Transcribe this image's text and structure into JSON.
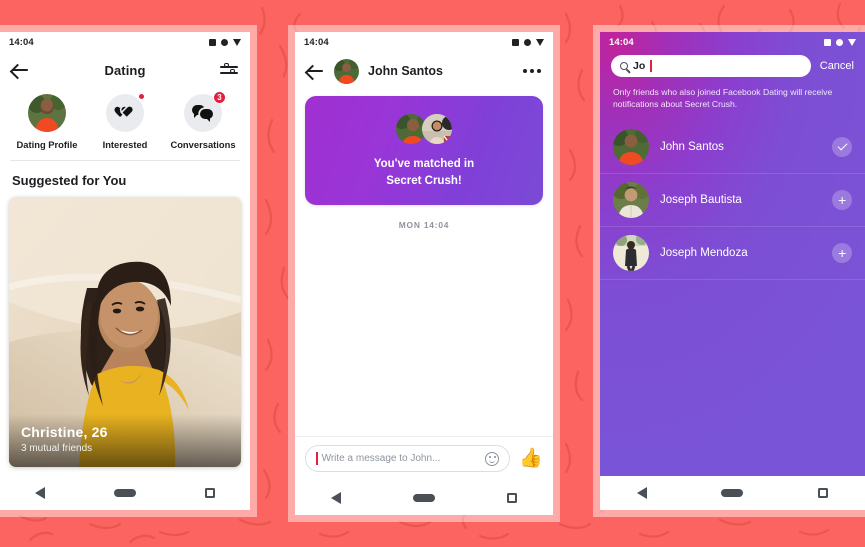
{
  "background": {
    "color": "#fb6461",
    "pattern": "squiggle-lines"
  },
  "phone1": {
    "status": {
      "time": "14:04",
      "icons": [
        "sim-icon",
        "circle-icon",
        "signal-triangle-icon"
      ]
    },
    "appbar": {
      "back": "back-arrow-icon",
      "title": "Dating",
      "settings": "filter-sliders-icon"
    },
    "shortcuts": [
      {
        "label": "Dating Profile",
        "icon": "profile-photo-icon",
        "badge": ""
      },
      {
        "label": "Interested",
        "icon": "hearts-icon",
        "badge": "dot"
      },
      {
        "label": "Conversations",
        "icon": "chat-bubbles-icon",
        "badge": "3"
      }
    ],
    "section_title": "Suggested for You",
    "card": {
      "name": "Christine, 26",
      "sub": "3 mutual friends"
    },
    "nav": [
      "back-nav-icon",
      "home-nav-icon",
      "recents-nav-icon"
    ]
  },
  "phone2": {
    "status": {
      "time": "14:04"
    },
    "appbar": {
      "back": "back-arrow-icon",
      "name": "John Santos",
      "menu": "overflow-menu-icon"
    },
    "banner": {
      "text_line1": "You've matched in",
      "text_line2": "Secret Crush!",
      "gradient_from": "#a02fd0",
      "gradient_to": "#7b4ad6"
    },
    "message_time": "MON 14:04",
    "composer": {
      "placeholder": "Write a message to John...",
      "emoji": "smiley-icon",
      "like": "thumbs-up-icon"
    },
    "nav": [
      "back-nav-icon",
      "home-nav-icon",
      "recents-nav-icon"
    ]
  },
  "phone3": {
    "status": {
      "time": "14:04"
    },
    "search": {
      "value": "Jo",
      "icon": "search-icon",
      "cancel": "Cancel"
    },
    "note": "Only friends who also joined Facebook Dating will receive notifications about Secret Crush.",
    "friends": [
      {
        "name": "John Santos",
        "action": "selected",
        "action_icon": "check-icon"
      },
      {
        "name": "Joseph Bautista",
        "action": "add",
        "action_icon": "plus-icon"
      },
      {
        "name": "Joseph Mendoza",
        "action": "add",
        "action_icon": "plus-icon"
      }
    ],
    "nav": [
      "back-nav-icon",
      "home-nav-icon",
      "recents-nav-icon"
    ]
  }
}
